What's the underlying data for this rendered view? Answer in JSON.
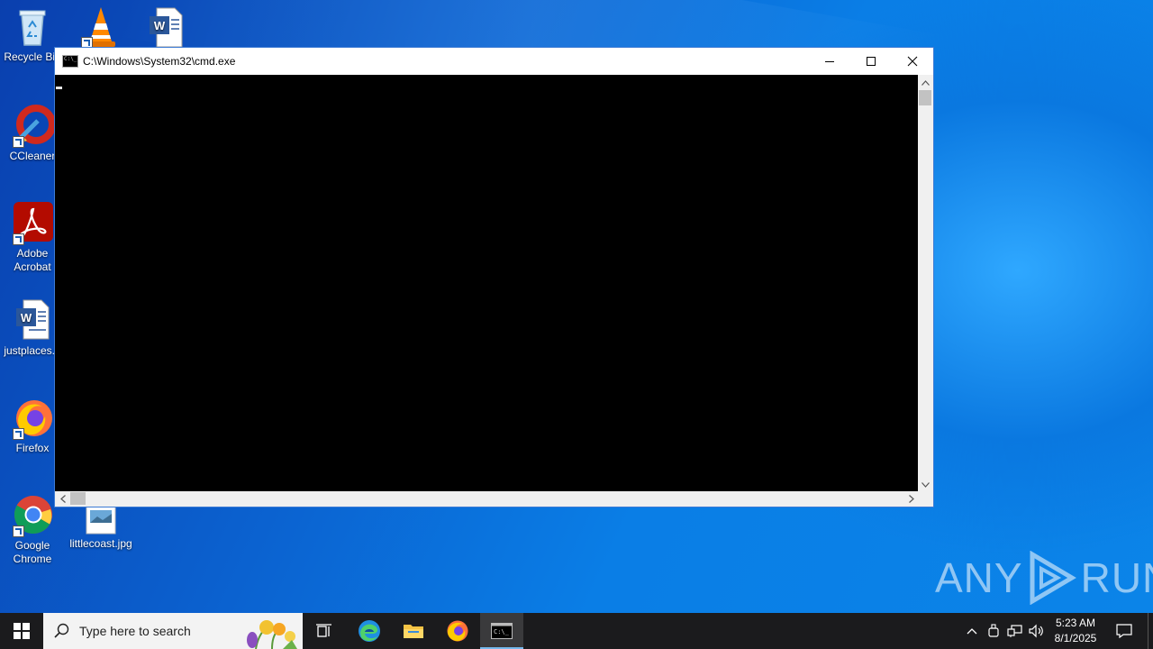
{
  "desktop": {
    "icons": [
      {
        "label": "Recycle Bin",
        "icon": "recycle-bin-icon"
      },
      {
        "label": "",
        "icon": "vlc-icon"
      },
      {
        "label": "",
        "icon": "word-doc-icon"
      },
      {
        "label": "CCleaner",
        "icon": "ccleaner-icon"
      },
      {
        "label": "Adobe Acrobat",
        "icon": "acrobat-icon"
      },
      {
        "label": "justplaces...",
        "icon": "word-doc-icon"
      },
      {
        "label": "Firefox",
        "icon": "firefox-icon"
      },
      {
        "label": "Google Chrome",
        "icon": "chrome-icon"
      },
      {
        "label": "littlecoast.jpg",
        "icon": "image-file-icon"
      }
    ]
  },
  "cmd_window": {
    "title": "C:\\Windows\\System32\\cmd.exe",
    "content": ""
  },
  "watermark": {
    "left": "ANY",
    "right": "RUN"
  },
  "taskbar": {
    "search_placeholder": "Type here to search",
    "apps": [
      "task-view",
      "edge",
      "file-explorer",
      "firefox",
      "cmd"
    ],
    "active_app": "cmd",
    "clock_time": "5:23 AM",
    "clock_date": "8/1/2025"
  },
  "colors": {
    "accent": "#76b9ed",
    "taskbar": "#1b1b1d",
    "console_bg": "#000000"
  }
}
